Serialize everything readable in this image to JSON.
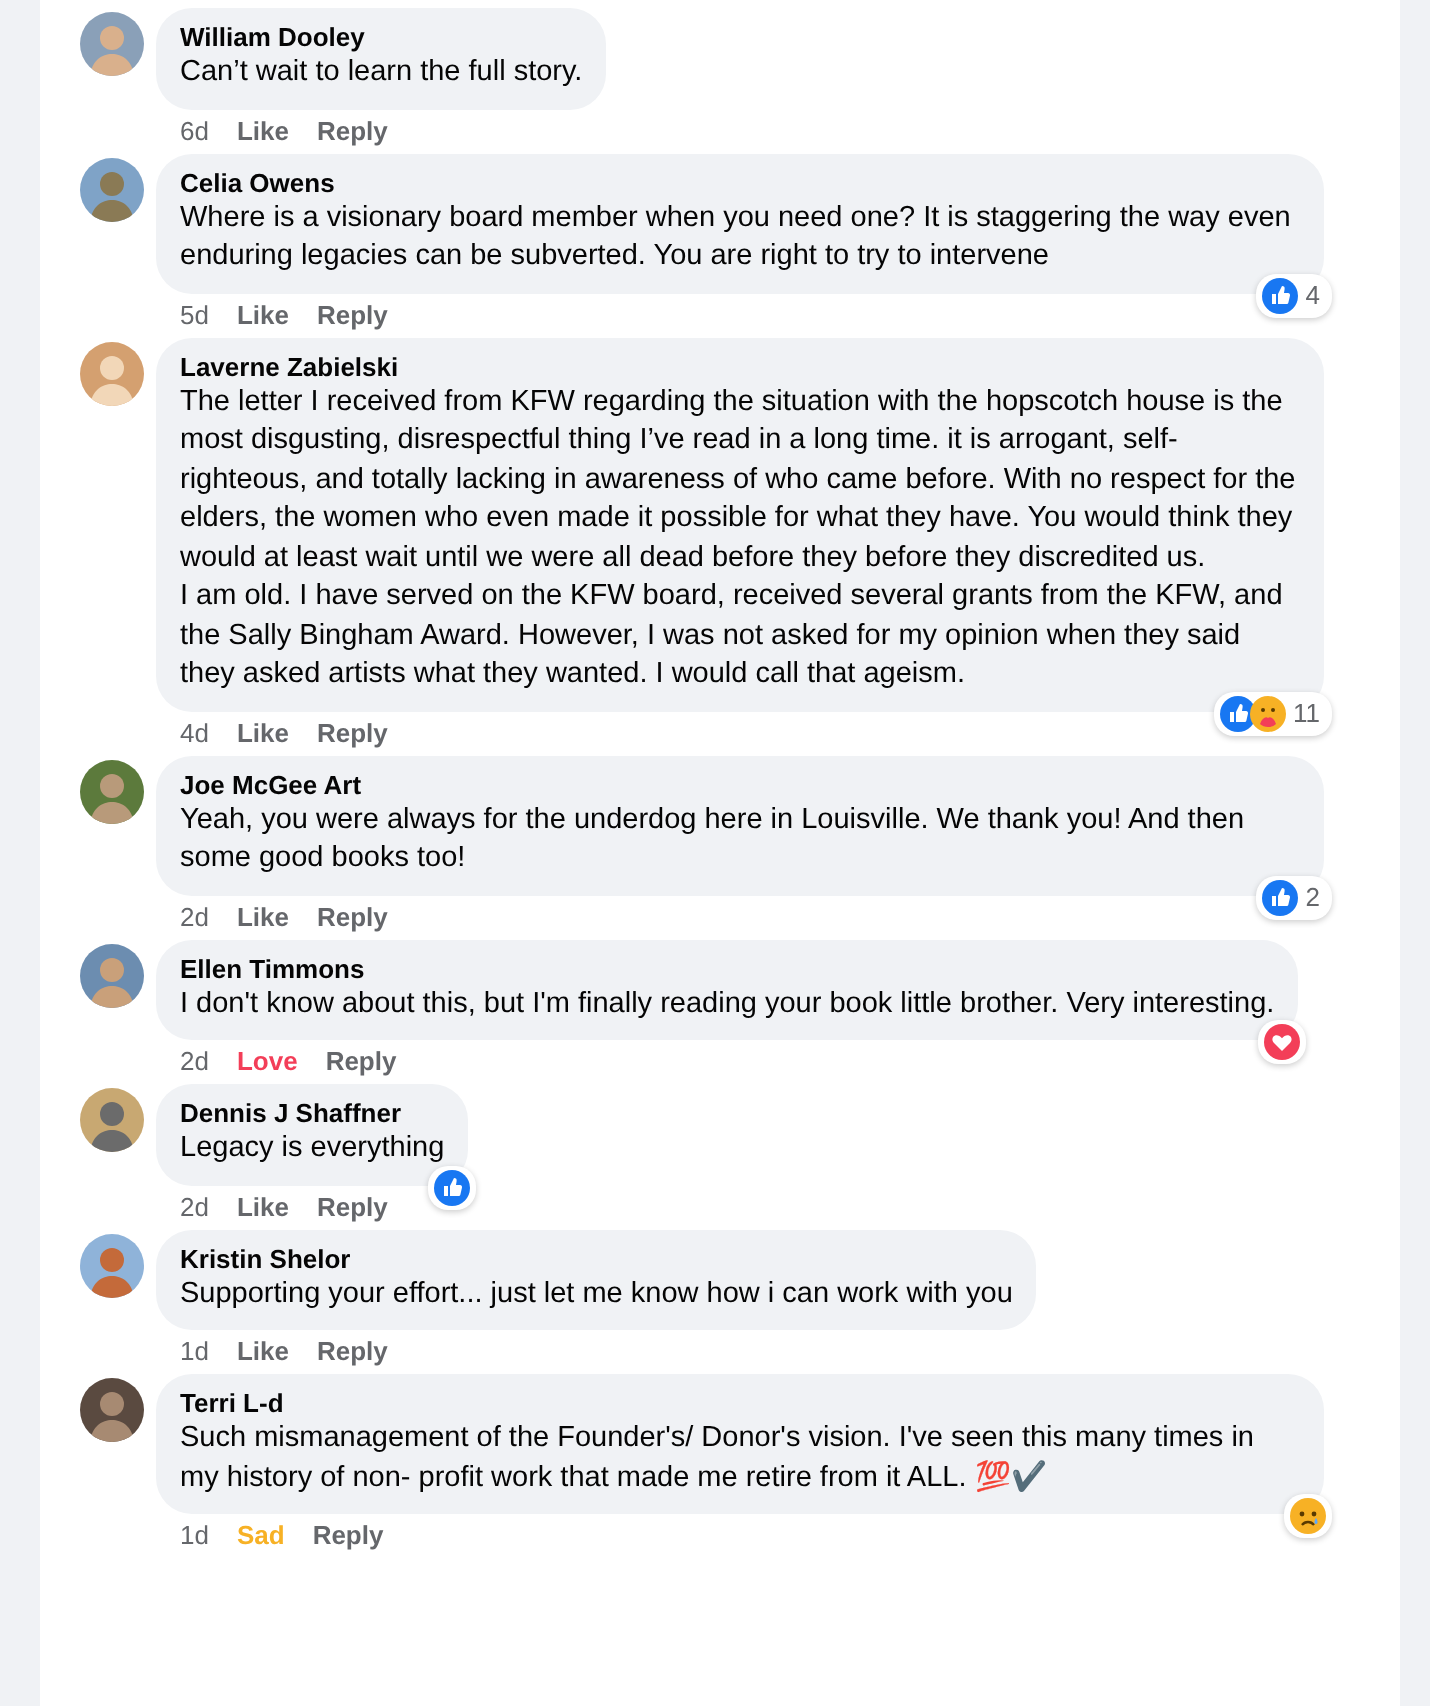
{
  "comments": [
    {
      "author": "William Dooley",
      "paragraphs": [
        "Can’t wait to learn the full story."
      ],
      "time": "6d",
      "reaction_action": {
        "label": "Like",
        "kind": "none"
      },
      "reply": "Reply"
    },
    {
      "author": "Celia Owens",
      "paragraphs": [
        "Where is a visionary board member when you need one? It is staggering the way even enduring legacies can be subverted. You are right to try to intervene"
      ],
      "time": "5d",
      "reaction_action": {
        "label": "Like",
        "kind": "none"
      },
      "reply": "Reply",
      "reactions": [
        {
          "kind": "like"
        }
      ],
      "reaction_count": "4"
    },
    {
      "author": "Laverne Zabielski",
      "paragraphs": [
        "The letter I received from KFW regarding the situation with the hopscotch house is the most disgusting, disrespectful thing I’ve read in a long time. it is arrogant, self-righteous, and totally lacking in awareness of who came before. With no respect for the elders, the women who even made it possible for what they have. You would think they would at least wait until we were all dead before they before they discredited us.",
        "I am old. I have served on the KFW board, received several grants from the KFW, and the Sally Bingham Award. However, I was not asked for my opinion when they said they asked artists what they wanted. I would call that ageism."
      ],
      "time": "4d",
      "reaction_action": {
        "label": "Like",
        "kind": "none"
      },
      "reply": "Reply",
      "reactions": [
        {
          "kind": "like"
        },
        {
          "kind": "care"
        }
      ],
      "reaction_count": "11"
    },
    {
      "author": "Joe McGee Art",
      "paragraphs": [
        "Yeah, you were always for the underdog here in Louisville. We thank you! And then some good books too!"
      ],
      "time": "2d",
      "reaction_action": {
        "label": "Like",
        "kind": "none"
      },
      "reply": "Reply",
      "reactions": [
        {
          "kind": "like"
        }
      ],
      "reaction_count": "2"
    },
    {
      "author": "Ellen Timmons",
      "paragraphs": [
        "I don't know about this, but I'm finally reading your book little brother. Very interesting."
      ],
      "time": "2d",
      "reaction_action": {
        "label": "Love",
        "kind": "love"
      },
      "reply": "Reply",
      "reactions": [
        {
          "kind": "love"
        }
      ]
    },
    {
      "author": "Dennis J Shaffner",
      "paragraphs": [
        "Legacy is everything"
      ],
      "time": "2d",
      "reaction_action": {
        "label": "Like",
        "kind": "none"
      },
      "reply": "Reply",
      "reactions": [
        {
          "kind": "like"
        }
      ]
    },
    {
      "author": "Kristin Shelor",
      "paragraphs": [
        "Supporting your effort... just let me know how i can work with you"
      ],
      "time": "1d",
      "reaction_action": {
        "label": "Like",
        "kind": "none"
      },
      "reply": "Reply"
    },
    {
      "author": "Terri L-d",
      "paragraphs": [
        "Such mismanagement of the Founder's/ Donor's vision. I've seen this many times in my history of non- profit work that made me retire from it ALL. 💯✔️"
      ],
      "time": "1d",
      "reaction_action": {
        "label": "Sad",
        "kind": "sad"
      },
      "reply": "Reply",
      "reactions": [
        {
          "kind": "sad"
        }
      ]
    }
  ]
}
